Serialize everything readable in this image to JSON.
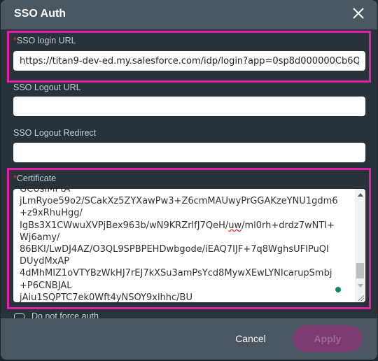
{
  "dialog": {
    "title": "SSO Auth",
    "close_icon": "close-icon"
  },
  "fields": {
    "login_url": {
      "label": "SSO login URL",
      "required": true,
      "value": "https://titan9-dev-ed.my.salesforce.com/idp/login?app=0sp8d000000Cb6Q"
    },
    "logout_url": {
      "label": "SSO Logout URL",
      "value": ""
    },
    "logout_redirect": {
      "label": "SSO Logout Redirect",
      "value": ""
    },
    "certificate": {
      "label": "Certificate",
      "required": true,
      "lines": [
        "GCUsIMPtA",
        "jLmRyoe59o2/SCakXz5ZYXawPw3+Z6cmMAUwyPrGGAKzeYNU1gdm6",
        "+z9xRhuHgg/",
        "IgBs3X1CWwuXVPjBex963b/wN9KRZrlfJ7QeH/",
        "uw",
        "/ml0rh+drdz7wNTI+",
        "Wj6amy/",
        "86BKI/LwDJ4AZ/O3QL9SPBPEHDwbgode/iEAQ7IJF+7q8WghsUFIPuQI",
        "DUydMxAP",
        "4dMhMIZ1oVTYBzWkHJ7rEJ7kXSu3amPsYcd8MywXEwLYNIcarupSmbj",
        "+P6CNBJAL",
        "jAiu1SQPTC7ek0Wft4yNSOY9xlhhc/BU"
      ]
    },
    "no_force_auth": {
      "label": "Do not force auth",
      "checked": false
    }
  },
  "footer": {
    "cancel_label": "Cancel",
    "apply_label": "Apply",
    "apply_enabled": false
  },
  "colors": {
    "highlight": "#e41ea9",
    "header": "#4a5760",
    "body": "#283239",
    "apply": "#7b3a70"
  }
}
